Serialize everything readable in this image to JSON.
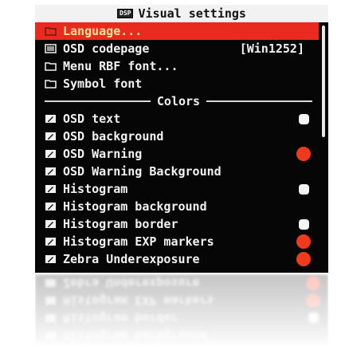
{
  "title": "Visual settings",
  "title_icon_text": "DSP",
  "menu": [
    {
      "label": "Language...",
      "icon": "folder-icon",
      "selected": true
    },
    {
      "label": "OSD codepage",
      "icon": "list-icon",
      "value": "[Win1252]"
    },
    {
      "label": "Menu RBF font...",
      "icon": "folder-icon"
    },
    {
      "label": "Symbol font",
      "icon": "folder-icon"
    }
  ],
  "colors_header": "Colors",
  "color_items": [
    {
      "label": "OSD text",
      "swatch": "white"
    },
    {
      "label": "OSD background",
      "swatch": "none"
    },
    {
      "label": "OSD Warning",
      "swatch": "red"
    },
    {
      "label": "OSD Warning Background",
      "swatch": "none"
    },
    {
      "label": "Histogram",
      "swatch": "white"
    },
    {
      "label": "Histogram background",
      "swatch": "none"
    },
    {
      "label": "Histogram border",
      "swatch": "white"
    },
    {
      "label": "Histogram EXP markers",
      "swatch": "red"
    },
    {
      "label": "Zebra Underexposure",
      "swatch": "red"
    }
  ],
  "colors": {
    "selected_bg": "#ea2a1e",
    "selected_text": "#ffe89a",
    "swatch_white": "#f4f4f4",
    "swatch_red": "#f03a1e"
  }
}
